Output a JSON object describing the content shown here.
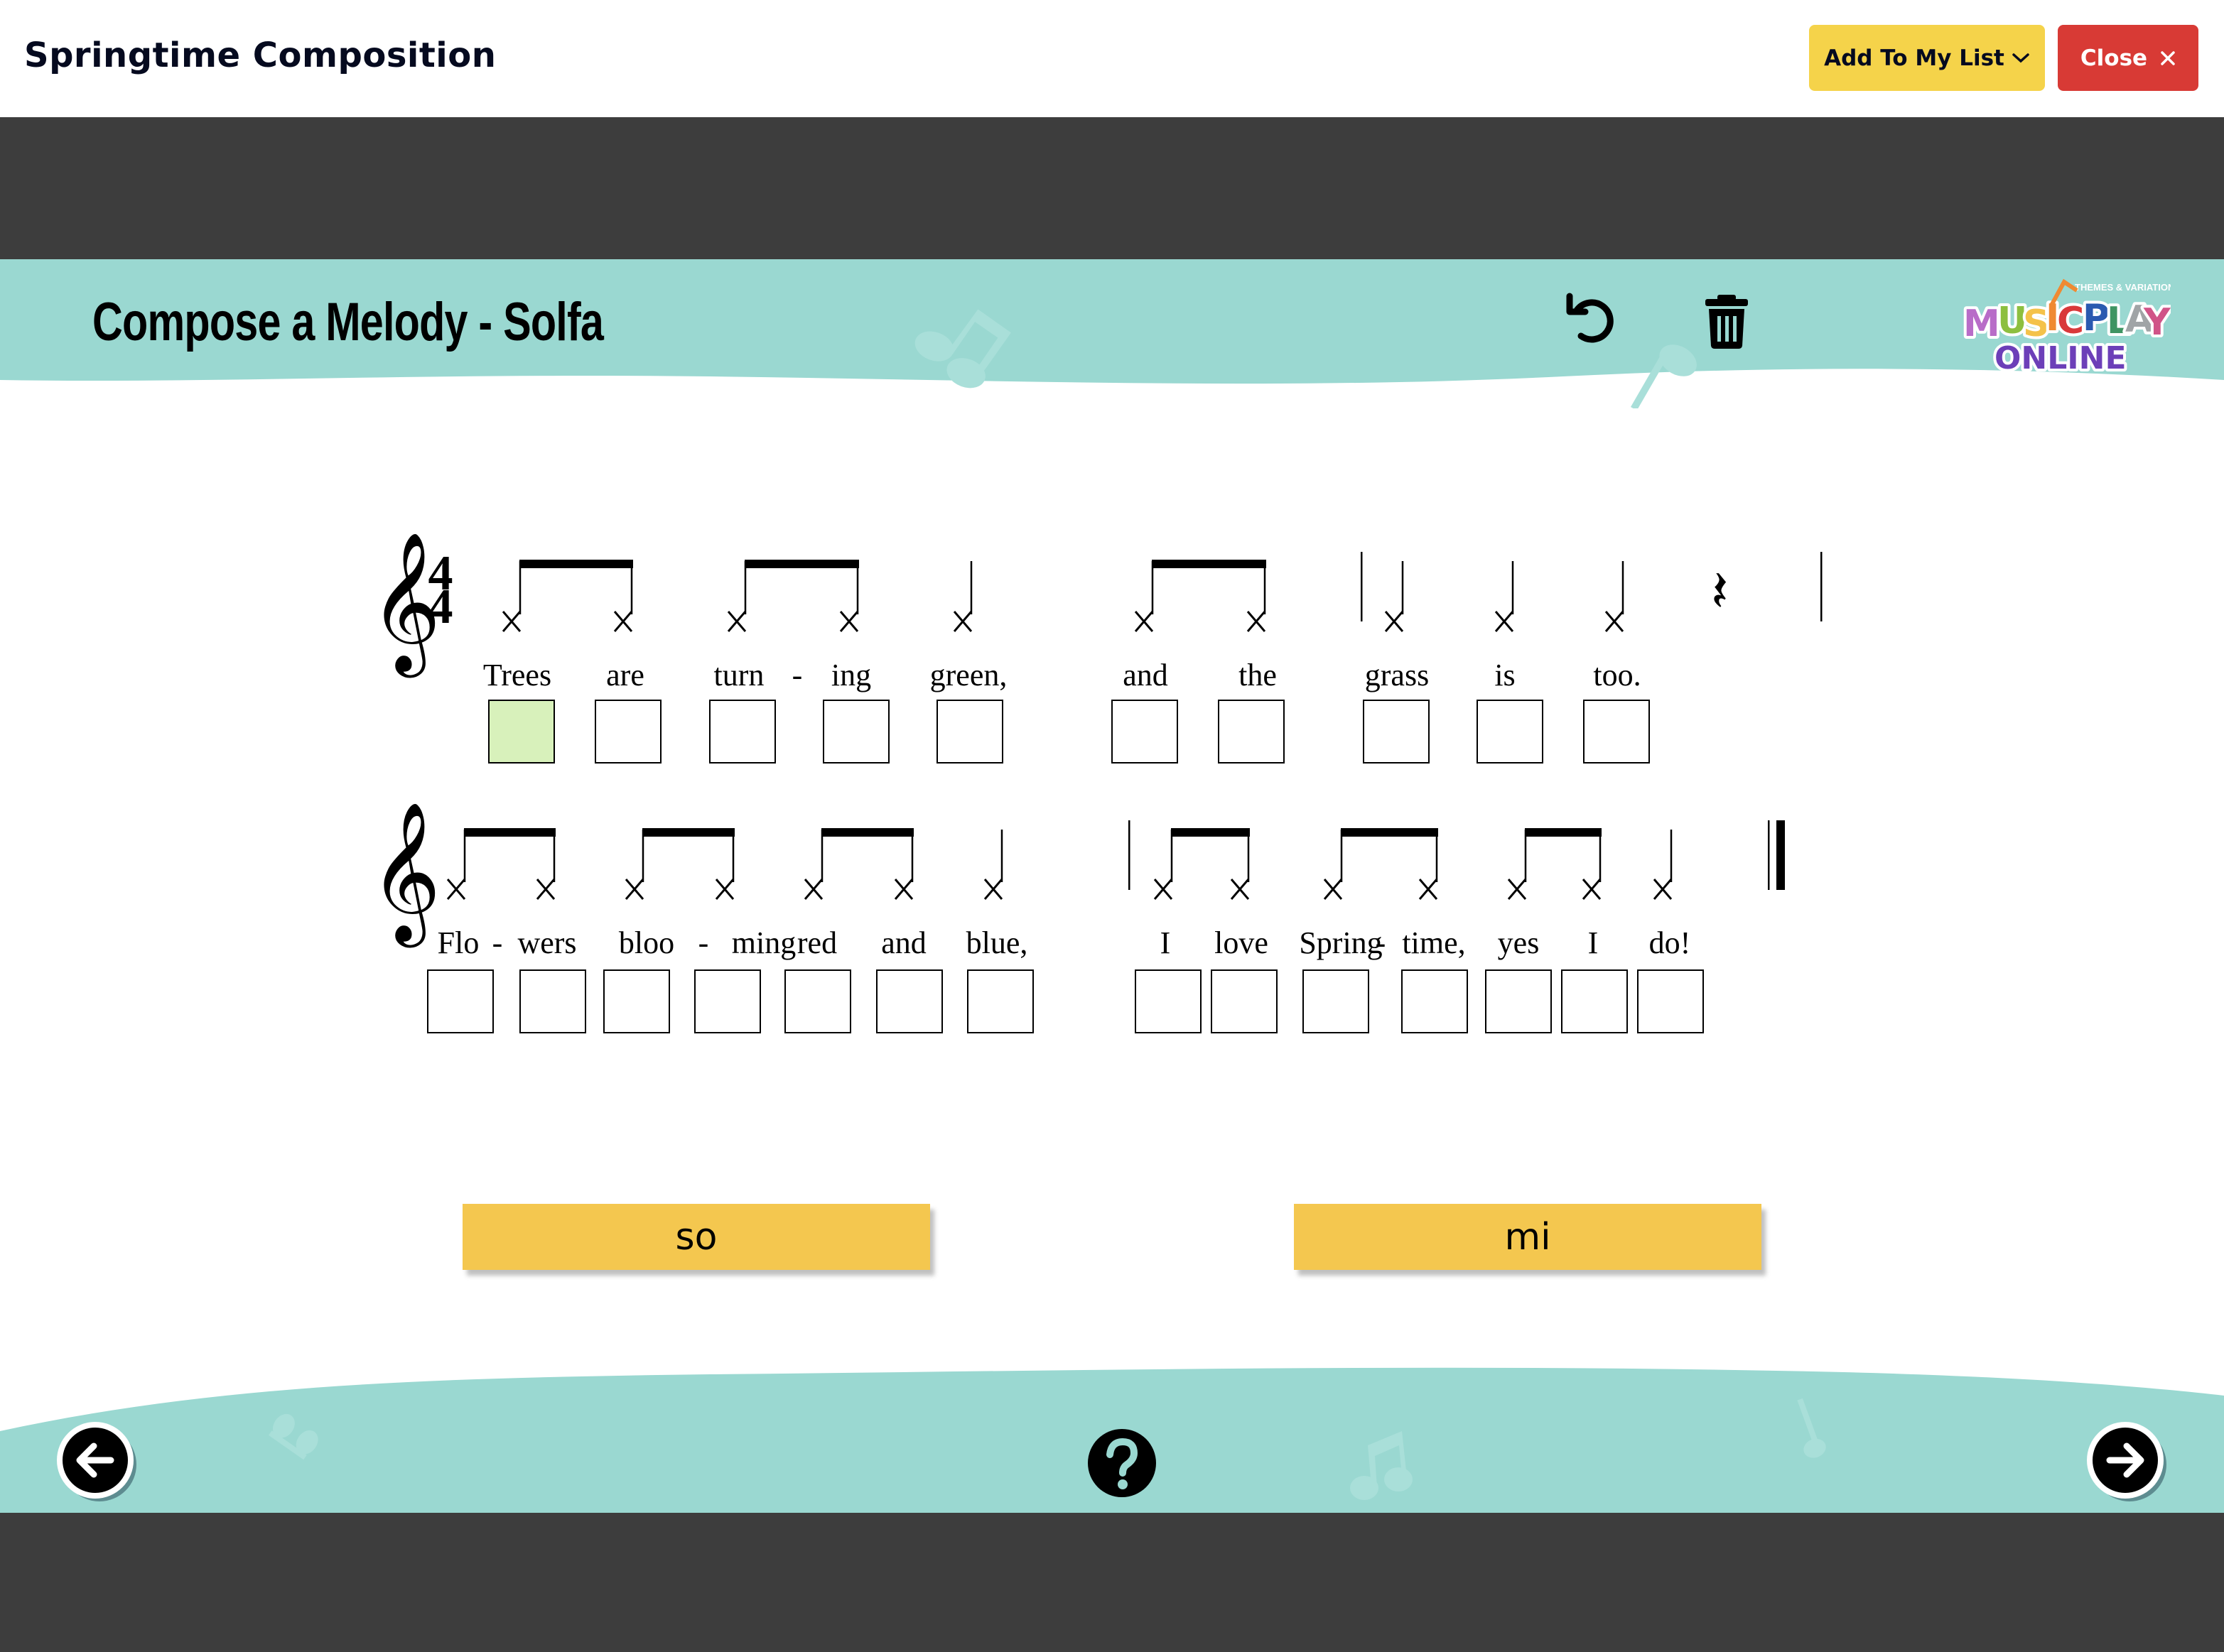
{
  "header": {
    "title": "Springtime Composition",
    "add_to_list_label": "Add To My List",
    "close_label": "Close"
  },
  "activity": {
    "title": "Compose a Melody - Solfa",
    "undo_icon": "undo-icon",
    "trash_icon": "trash-icon",
    "logo": {
      "tagline": "THEMES & VARIATIONS",
      "line1": "MUSICPLAY",
      "line2": "ONLINE"
    }
  },
  "score": {
    "time_signature": {
      "top": "4",
      "bottom": "4"
    },
    "line1": {
      "lyrics": [
        "Trees",
        "are",
        "turn",
        "-",
        "ing",
        "green,",
        "and",
        "the",
        "grass",
        "is",
        "too."
      ],
      "boxes": [
        {
          "syllable": "Trees",
          "filled": true
        },
        {
          "syllable": "are",
          "filled": false
        },
        {
          "syllable": "turn",
          "filled": false
        },
        {
          "syllable": "ing",
          "filled": false
        },
        {
          "syllable": "green,",
          "filled": false
        },
        {
          "syllable": "and",
          "filled": false
        },
        {
          "syllable": "the",
          "filled": false
        },
        {
          "syllable": "grass",
          "filled": false
        },
        {
          "syllable": "is",
          "filled": false
        },
        {
          "syllable": "too.",
          "filled": false
        }
      ]
    },
    "line2": {
      "lyrics": [
        "Flo",
        "-",
        "wers",
        "bloo",
        "-",
        "ming",
        "red",
        "and",
        "blue,",
        "I",
        "love",
        "Spring",
        "-",
        "time,",
        "yes",
        "I",
        "do!"
      ],
      "boxes": [
        {
          "syllable": "Flo",
          "filled": false
        },
        {
          "syllable": "wers",
          "filled": false
        },
        {
          "syllable": "bloo",
          "filled": false
        },
        {
          "syllable": "ming",
          "filled": false
        },
        {
          "syllable": "red",
          "filled": false
        },
        {
          "syllable": "and",
          "filled": false
        },
        {
          "syllable": "blue,",
          "filled": false
        },
        {
          "syllable": "I",
          "filled": false
        },
        {
          "syllable": "love",
          "filled": false
        },
        {
          "syllable": "Spring",
          "filled": false
        },
        {
          "syllable": "time,",
          "filled": false
        },
        {
          "syllable": "yes",
          "filled": false
        },
        {
          "syllable": "I",
          "filled": false
        },
        {
          "syllable": "do!",
          "filled": false
        }
      ]
    }
  },
  "solfa_options": [
    {
      "label": "so"
    },
    {
      "label": "mi"
    }
  ],
  "footer": {
    "prev_icon": "arrow-left-icon",
    "help_icon": "question-icon",
    "next_icon": "arrow-right-icon"
  },
  "colors": {
    "teal": "#9ad8d1",
    "dark": "#3d3d3d",
    "yellow_button": "#f5d34a",
    "red_button": "#d83a35",
    "solfa_button": "#f4c74f",
    "filled_box": "#d8f1bb"
  }
}
